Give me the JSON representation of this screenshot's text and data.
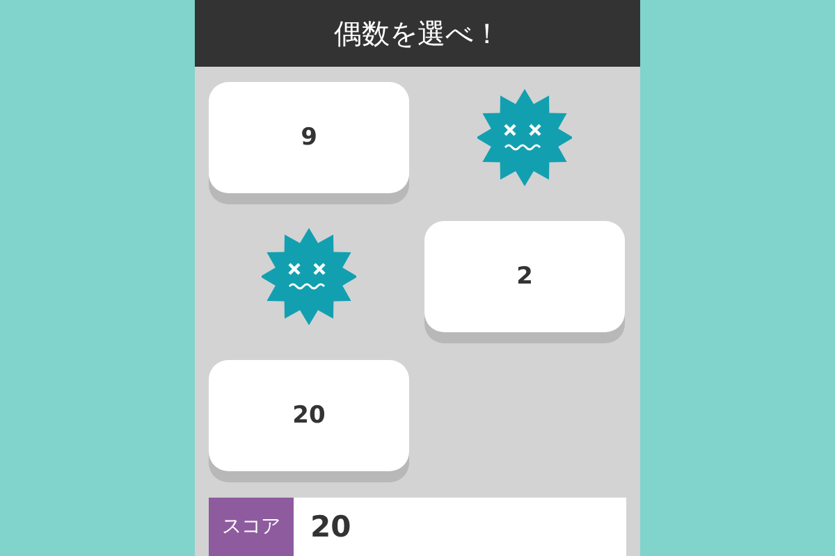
{
  "header": {
    "title": "偶数を選べ！"
  },
  "cells": [
    {
      "kind": "card",
      "label": "9"
    },
    {
      "kind": "monster"
    },
    {
      "kind": "monster"
    },
    {
      "kind": "card",
      "label": "2"
    },
    {
      "kind": "card",
      "label": "20"
    }
  ],
  "score": {
    "label": "スコア",
    "value": "20"
  }
}
